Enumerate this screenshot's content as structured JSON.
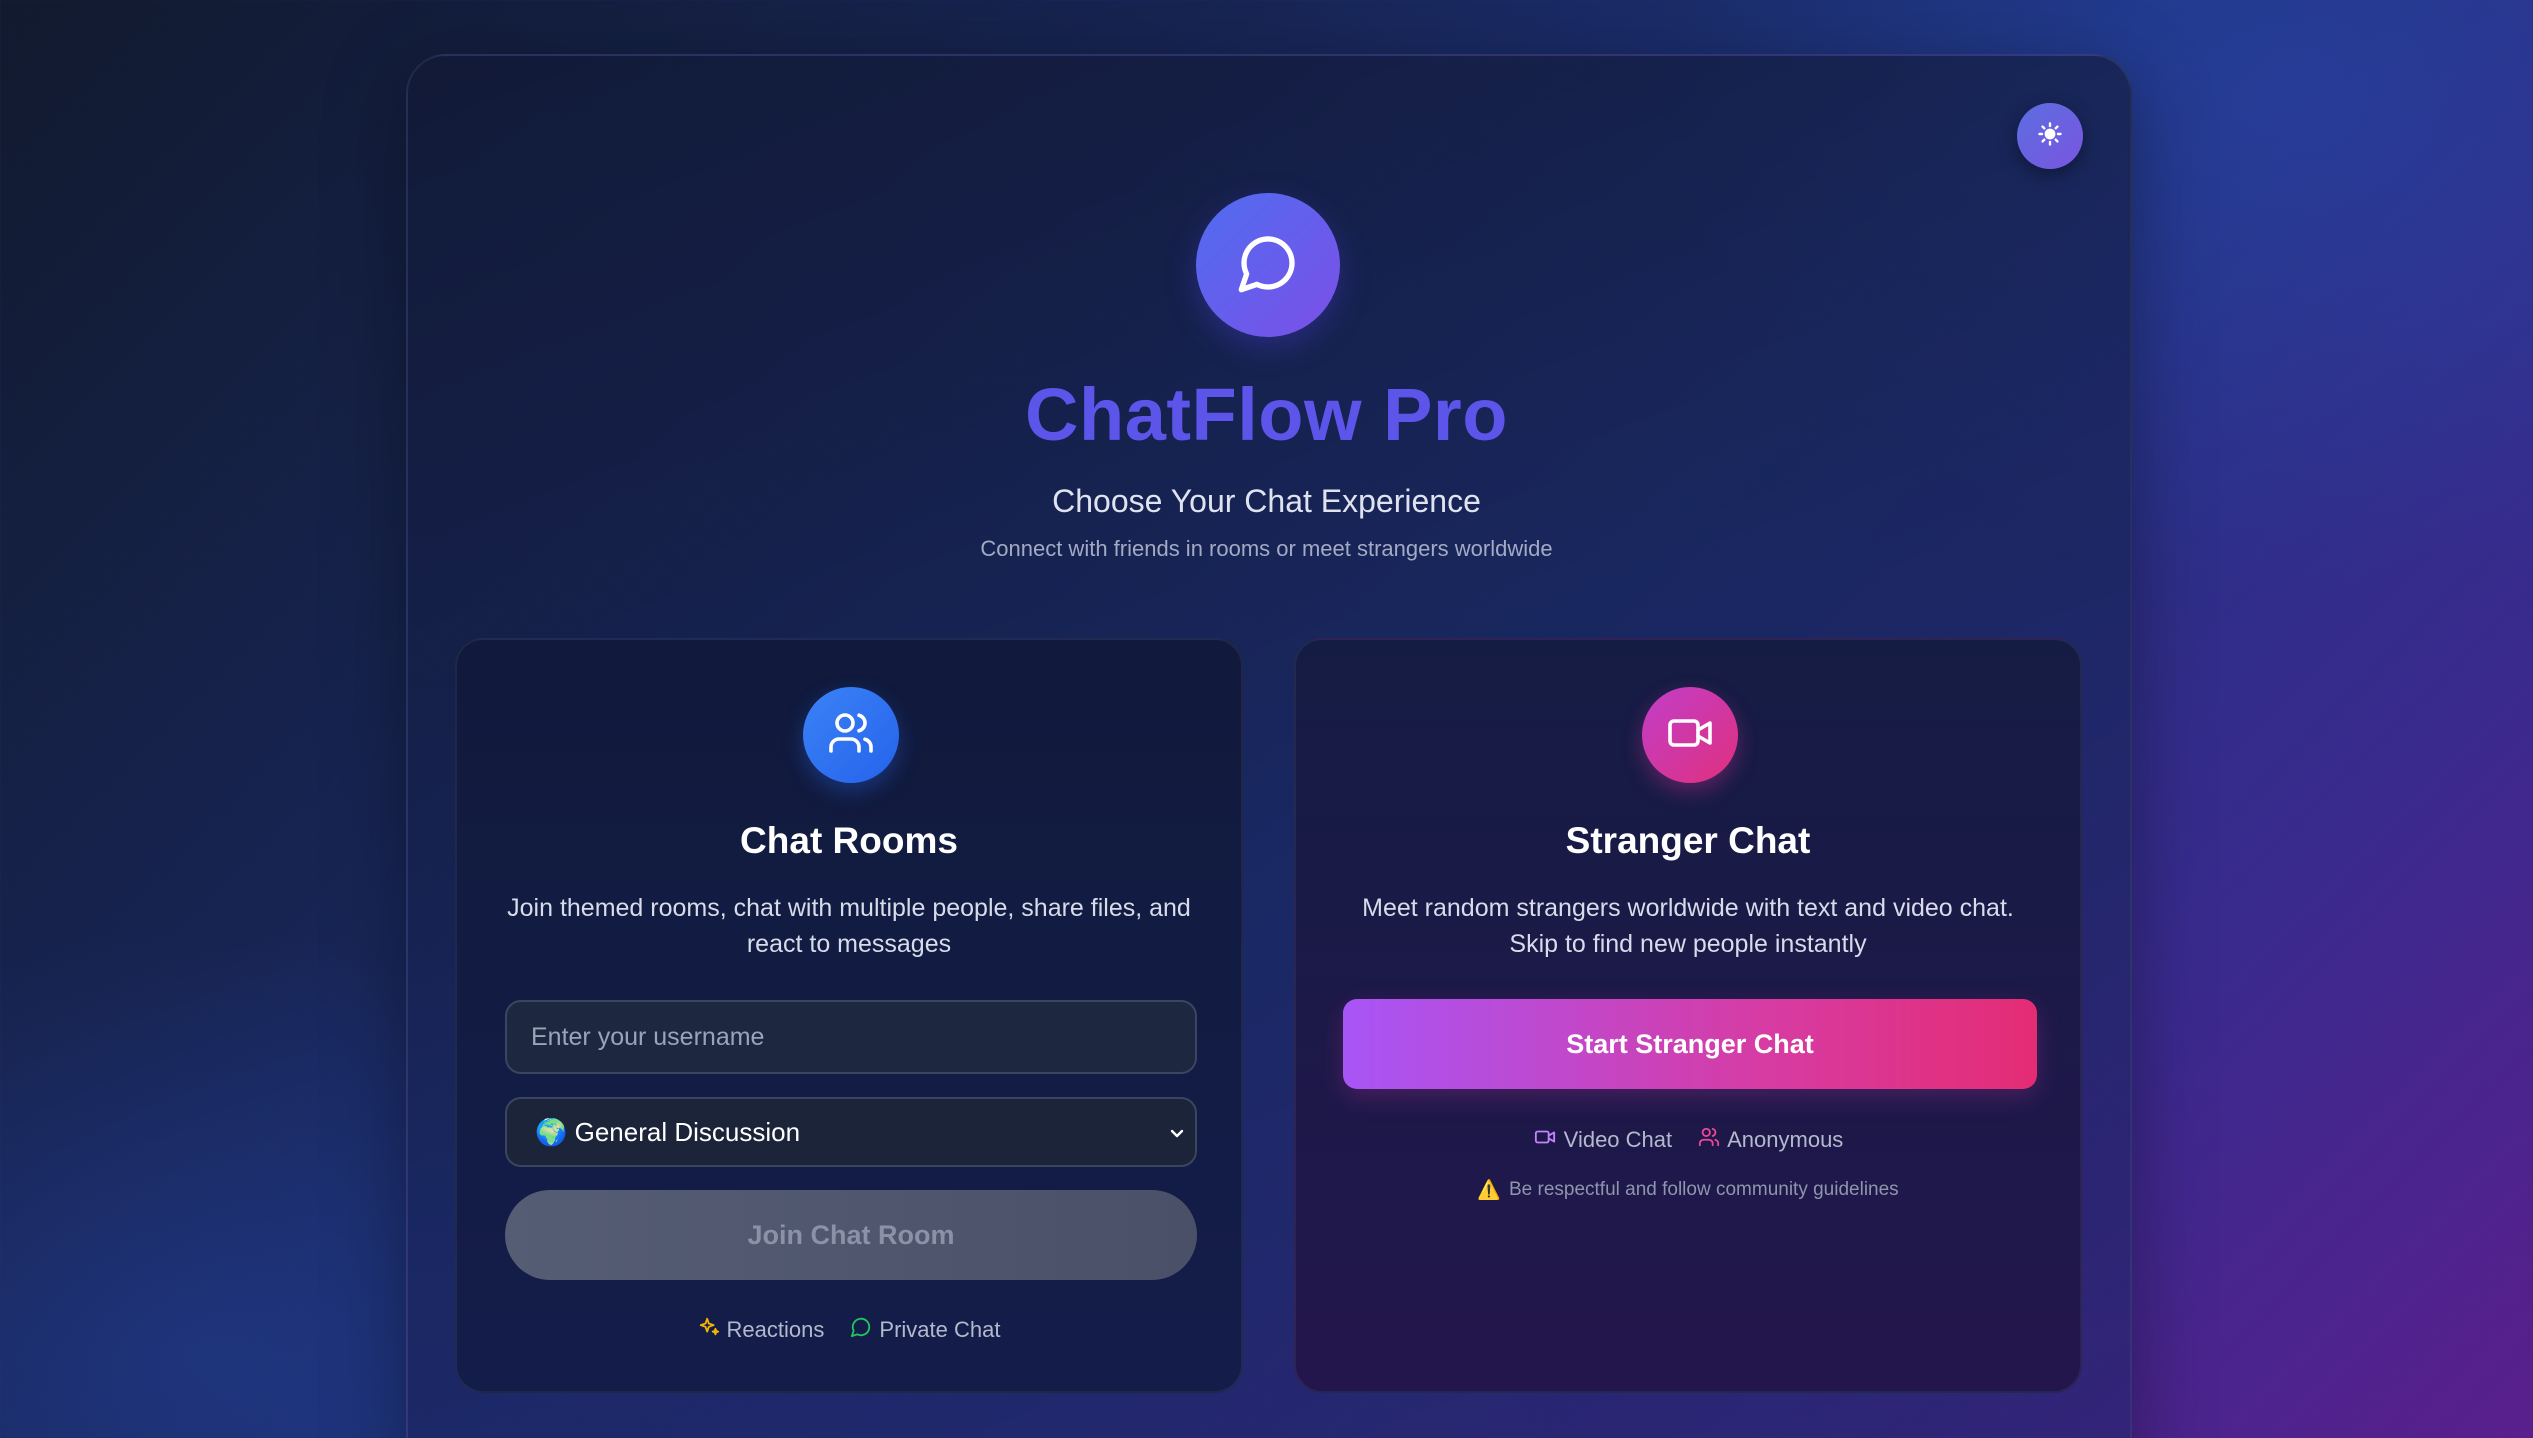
{
  "theme_toggle": {
    "icon": "sun-icon"
  },
  "header": {
    "logo_icon": "message-circle-icon",
    "title": "ChatFlow Pro",
    "subtitle": "Choose Your Chat Experience",
    "tagline": "Connect with friends in rooms or meet strangers worldwide"
  },
  "chat_rooms": {
    "icon": "users-icon",
    "title": "Chat Rooms",
    "description": "Join themed rooms, chat with multiple people, share files, and react to messages",
    "username_placeholder": "Enter your username",
    "username_value": "",
    "selected_room": "🌍 General Discussion",
    "join_label": "Join Chat Room",
    "features": [
      {
        "icon": "sparkles-icon",
        "label": "Reactions"
      },
      {
        "icon": "message-circle-icon",
        "label": "Private Chat"
      }
    ]
  },
  "stranger_chat": {
    "icon": "video-icon",
    "title": "Stranger Chat",
    "description": "Meet random strangers worldwide with text and video chat. Skip to find new people instantly",
    "start_label": "Start Stranger Chat",
    "features": [
      {
        "icon": "video-icon",
        "label": "Video Chat"
      },
      {
        "icon": "users-icon",
        "label": "Anonymous"
      }
    ],
    "warning_icon": "⚠️",
    "warning": "Be respectful and follow community guidelines"
  },
  "colors": {
    "accent": "#5d55ea",
    "blue": "#3b82f6",
    "pink": "#e42c74",
    "purple": "#a855f7"
  }
}
